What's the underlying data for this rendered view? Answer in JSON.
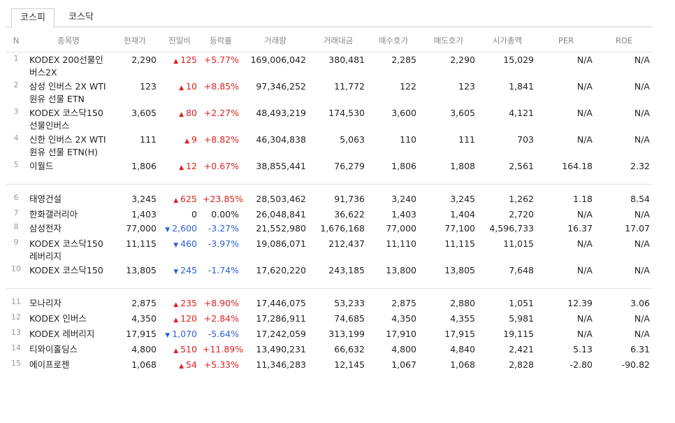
{
  "tabs": [
    "코스피",
    "코스닥"
  ],
  "columns": [
    "N",
    "종목명",
    "현재가",
    "전일비",
    "등락률",
    "거래량",
    "거래대금",
    "매수호가",
    "매도호가",
    "시가총액",
    "PER",
    "ROE"
  ],
  "rows": [
    {
      "n": "1",
      "name": "KODEX 200선물인버스2X",
      "price": "2,290",
      "dir": "up",
      "change": "125",
      "rate": "+5.77%",
      "volume": "169,006,042",
      "amount": "380,481",
      "bid": "2,285",
      "ask": "2,290",
      "cap": "15,029",
      "per": "N/A",
      "roe": "N/A"
    },
    {
      "n": "2",
      "name": "삼성 인버스 2X WTI원유 선물 ETN",
      "price": "123",
      "dir": "up",
      "change": "10",
      "rate": "+8.85%",
      "volume": "97,346,252",
      "amount": "11,772",
      "bid": "122",
      "ask": "123",
      "cap": "1,841",
      "per": "N/A",
      "roe": "N/A"
    },
    {
      "n": "3",
      "name": "KODEX 코스닥150선물인버스",
      "price": "3,605",
      "dir": "up",
      "change": "80",
      "rate": "+2.27%",
      "volume": "48,493,219",
      "amount": "174,530",
      "bid": "3,600",
      "ask": "3,605",
      "cap": "4,121",
      "per": "N/A",
      "roe": "N/A"
    },
    {
      "n": "4",
      "name": "신한 인버스 2X WTI원유 선물 ETN(H)",
      "price": "111",
      "dir": "up",
      "change": "9",
      "rate": "+8.82%",
      "volume": "46,304,838",
      "amount": "5,063",
      "bid": "110",
      "ask": "111",
      "cap": "703",
      "per": "N/A",
      "roe": "N/A"
    },
    {
      "n": "5",
      "name": "이월드",
      "price": "1,806",
      "dir": "up",
      "change": "12",
      "rate": "+0.67%",
      "volume": "38,855,441",
      "amount": "76,279",
      "bid": "1,806",
      "ask": "1,808",
      "cap": "2,561",
      "per": "164.18",
      "roe": "2.32"
    },
    {
      "n": "6",
      "name": "태영건설",
      "price": "3,245",
      "dir": "up",
      "change": "625",
      "rate": "+23.85%",
      "volume": "28,503,462",
      "amount": "91,736",
      "bid": "3,240",
      "ask": "3,245",
      "cap": "1,262",
      "per": "1.18",
      "roe": "8.54"
    },
    {
      "n": "7",
      "name": "한화갤러리아",
      "price": "1,403",
      "dir": "none",
      "change": "0",
      "rate": "0.00%",
      "volume": "26,048,841",
      "amount": "36,622",
      "bid": "1,403",
      "ask": "1,404",
      "cap": "2,720",
      "per": "N/A",
      "roe": "N/A"
    },
    {
      "n": "8",
      "name": "삼성전자",
      "price": "77,000",
      "dir": "down",
      "change": "2,600",
      "rate": "-3.27%",
      "volume": "21,552,980",
      "amount": "1,676,168",
      "bid": "77,000",
      "ask": "77,100",
      "cap": "4,596,733",
      "per": "16.37",
      "roe": "17.07"
    },
    {
      "n": "9",
      "name": "KODEX 코스닥150 레버리지",
      "price": "11,115",
      "dir": "down",
      "change": "460",
      "rate": "-3.97%",
      "volume": "19,086,071",
      "amount": "212,437",
      "bid": "11,110",
      "ask": "11,115",
      "cap": "11,015",
      "per": "N/A",
      "roe": "N/A"
    },
    {
      "n": "10",
      "name": "KODEX 코스닥150",
      "price": "13,805",
      "dir": "down",
      "change": "245",
      "rate": "-1.74%",
      "volume": "17,620,220",
      "amount": "243,185",
      "bid": "13,800",
      "ask": "13,805",
      "cap": "7,648",
      "per": "N/A",
      "roe": "N/A"
    },
    {
      "n": "11",
      "name": "모나리자",
      "price": "2,875",
      "dir": "up",
      "change": "235",
      "rate": "+8.90%",
      "volume": "17,446,075",
      "amount": "53,233",
      "bid": "2,875",
      "ask": "2,880",
      "cap": "1,051",
      "per": "12.39",
      "roe": "3.06"
    },
    {
      "n": "12",
      "name": "KODEX 인버스",
      "price": "4,350",
      "dir": "up",
      "change": "120",
      "rate": "+2.84%",
      "volume": "17,286,911",
      "amount": "74,685",
      "bid": "4,350",
      "ask": "4,355",
      "cap": "5,981",
      "per": "N/A",
      "roe": "N/A"
    },
    {
      "n": "13",
      "name": "KODEX 레버리지",
      "price": "17,915",
      "dir": "down",
      "change": "1,070",
      "rate": "-5.64%",
      "volume": "17,242,059",
      "amount": "313,199",
      "bid": "17,910",
      "ask": "17,915",
      "cap": "19,115",
      "per": "N/A",
      "roe": "N/A"
    },
    {
      "n": "14",
      "name": "티와이홀딩스",
      "price": "4,800",
      "dir": "up",
      "change": "510",
      "rate": "+11.89%",
      "volume": "13,490,231",
      "amount": "66,632",
      "bid": "4,800",
      "ask": "4,840",
      "cap": "2,421",
      "per": "5.13",
      "roe": "6.31"
    },
    {
      "n": "15",
      "name": "에이프로젠",
      "price": "1,068",
      "dir": "up",
      "change": "54",
      "rate": "+5.33%",
      "volume": "11,346,283",
      "amount": "12,145",
      "bid": "1,067",
      "ask": "1,068",
      "cap": "2,828",
      "per": "-2.80",
      "roe": "-90.82"
    }
  ],
  "colors": {
    "up": "#e02020",
    "down": "#2f62d6",
    "text": "#222222",
    "muted": "#888888"
  },
  "icons": {
    "up": "triangle-up-icon",
    "down": "triangle-down-icon"
  }
}
